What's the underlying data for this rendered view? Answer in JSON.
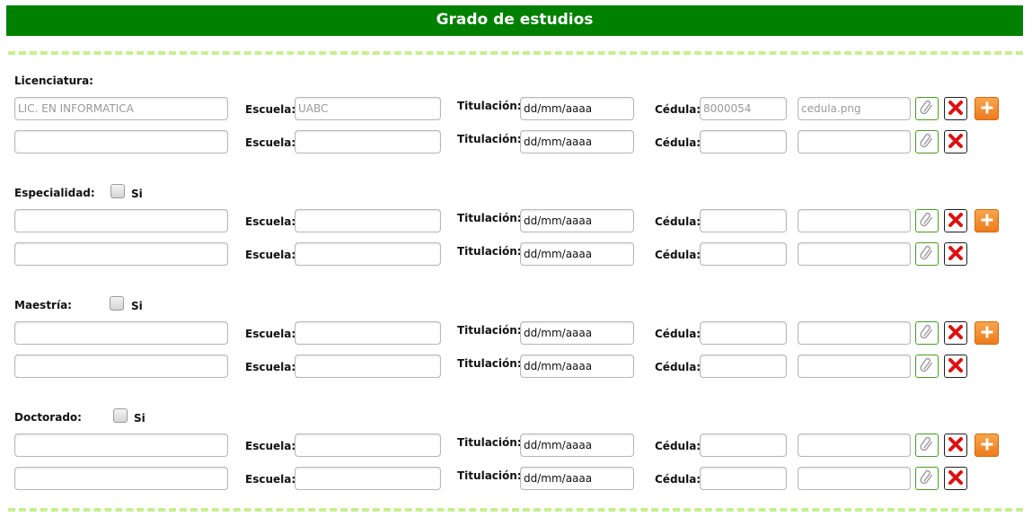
{
  "header": {
    "title": "Grado de estudios"
  },
  "labels": {
    "escuela": "Escuela:",
    "titulacion": "Titulación:",
    "cedula": "Cédula:",
    "si": "Si"
  },
  "placeholders": {
    "fecha": "dd/mm/aaaa"
  },
  "sections": [
    {
      "title": "Licenciatura:",
      "has_checkbox": false,
      "checked": false,
      "rows": [
        {
          "degree": "LIC. EN INFORMATICA",
          "escuela": "UABC",
          "titulacion": "",
          "cedula": "8000054",
          "archivo": "cedula.png"
        },
        {
          "degree": "",
          "escuela": "",
          "titulacion": "",
          "cedula": "",
          "archivo": ""
        }
      ]
    },
    {
      "title": "Especialidad:",
      "has_checkbox": true,
      "checked": false,
      "rows": [
        {
          "degree": "",
          "escuela": "",
          "titulacion": "",
          "cedula": "",
          "archivo": ""
        },
        {
          "degree": "",
          "escuela": "",
          "titulacion": "",
          "cedula": "",
          "archivo": ""
        }
      ]
    },
    {
      "title": "Maestría:",
      "has_checkbox": true,
      "checked": false,
      "rows": [
        {
          "degree": "",
          "escuela": "",
          "titulacion": "",
          "cedula": "",
          "archivo": ""
        },
        {
          "degree": "",
          "escuela": "",
          "titulacion": "",
          "cedula": "",
          "archivo": ""
        }
      ]
    },
    {
      "title": "Doctorado:",
      "has_checkbox": true,
      "checked": false,
      "rows": [
        {
          "degree": "",
          "escuela": "",
          "titulacion": "",
          "cedula": "",
          "archivo": ""
        },
        {
          "degree": "",
          "escuela": "",
          "titulacion": "",
          "cedula": "",
          "archivo": ""
        }
      ]
    }
  ],
  "icons": {
    "attach": "paperclip-icon",
    "delete": "close-icon",
    "add": "plus-icon"
  },
  "colors": {
    "header": "#008000",
    "dash": "#c6f08f",
    "add": "#ee7b1c",
    "delete": "#dd1111"
  }
}
